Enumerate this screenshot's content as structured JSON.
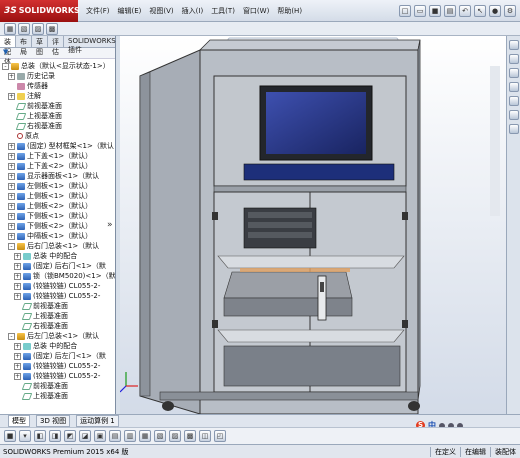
{
  "app": {
    "logo_text": "SOLIDWORKS",
    "logo_prefix": "3S"
  },
  "menu": [
    "文件(F)",
    "编辑(E)",
    "视图(V)",
    "插入(I)",
    "工具(T)",
    "窗口(W)",
    "帮助(H)"
  ],
  "panel_tabs": [
    "装配体",
    "布局",
    "草图",
    "评估",
    "SOLIDWORKS 插件"
  ],
  "tree": [
    {
      "label": "总装（默认<显示状态-1>）",
      "icon": "assembly-icon",
      "exp": "-"
    },
    {
      "label": "历史记录",
      "icon": "history-icon",
      "exp": "+"
    },
    {
      "label": "传感器",
      "icon": "sensor-icon",
      "exp": ""
    },
    {
      "label": "注解",
      "icon": "annotation-icon",
      "exp": "+"
    },
    {
      "label": "前视基准面",
      "icon": "plane-icon",
      "exp": ""
    },
    {
      "label": "上视基准面",
      "icon": "plane-icon",
      "exp": ""
    },
    {
      "label": "右视基准面",
      "icon": "plane-icon",
      "exp": ""
    },
    {
      "label": "原点",
      "icon": "origin-icon",
      "exp": ""
    },
    {
      "label": "(固定) 型材框架<1>（默认",
      "icon": "part-icon",
      "exp": "+"
    },
    {
      "label": "上下盖<1>（默认）",
      "icon": "part-icon",
      "exp": "+"
    },
    {
      "label": "上下盖<2>（默认）",
      "icon": "part-icon",
      "exp": "+"
    },
    {
      "label": "显示器面板<1>（默认",
      "icon": "part-icon",
      "exp": "+"
    },
    {
      "label": "左侧板<1>（默认）",
      "icon": "part-icon",
      "exp": "+"
    },
    {
      "label": "上侧板<1>（默认）",
      "icon": "part-icon",
      "exp": "+"
    },
    {
      "label": "上侧板<2>（默认）",
      "icon": "part-icon",
      "exp": "+"
    },
    {
      "label": "下侧板<1>（默认）",
      "icon": "part-icon",
      "exp": "+"
    },
    {
      "label": "下侧板<2>（默认）",
      "icon": "part-icon",
      "exp": "+"
    },
    {
      "label": "中隔板<1>（默认）",
      "icon": "part-icon",
      "exp": "+"
    },
    {
      "label": "后右门总装<1>（默认",
      "icon": "assembly-icon",
      "exp": "-"
    },
    {
      "label": "总装 中的配合",
      "icon": "mate-icon",
      "exp": "+"
    },
    {
      "label": "(固定) 后右门<1>（默",
      "icon": "part-icon",
      "exp": "+"
    },
    {
      "label": "锁（锁BM5020)<1>（默",
      "icon": "part-icon",
      "exp": "+"
    },
    {
      "label": "(铰链铰链) CL055-2-",
      "icon": "part-icon",
      "exp": "+"
    },
    {
      "label": "(铰链铰链) CL055-2-",
      "icon": "part-icon",
      "exp": "+"
    },
    {
      "label": "前视基准面",
      "icon": "plane-icon",
      "exp": ""
    },
    {
      "label": "上视基准面",
      "icon": "plane-icon",
      "exp": ""
    },
    {
      "label": "右视基准面",
      "icon": "plane-icon",
      "exp": ""
    },
    {
      "label": "后左门总装<1>（默认",
      "icon": "assembly-icon",
      "exp": "-"
    },
    {
      "label": "总装 中的配合",
      "icon": "mate-icon",
      "exp": "+"
    },
    {
      "label": "(固定) 后左门<1>（默",
      "icon": "part-icon",
      "exp": "+"
    },
    {
      "label": "(铰链铰链) CL055-2-",
      "icon": "part-icon",
      "exp": "+"
    },
    {
      "label": "(铰链铰链) CL055-2-",
      "icon": "part-icon",
      "exp": "+"
    },
    {
      "label": "前视基准面",
      "icon": "plane-icon",
      "exp": ""
    },
    {
      "label": "上视基准面",
      "icon": "plane-icon",
      "exp": ""
    }
  ],
  "bottom_tabs": [
    "模型",
    "3D 视图",
    "运动算例 1"
  ],
  "status": {
    "left": "SOLIDWORKS Premium 2015 x64 版",
    "right": [
      "在定义",
      "在编辑",
      "装配体"
    ]
  },
  "ime_label": "中"
}
